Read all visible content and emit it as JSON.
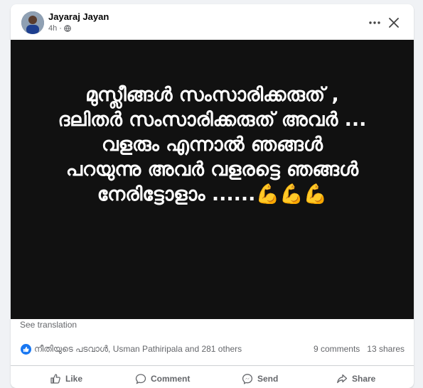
{
  "post": {
    "author": "Jayaraj Jayan",
    "time": "4h",
    "separator": "·",
    "privacy_icon": "globe-icon",
    "body_text": "മുസ്ലീങ്ങൾ സംസാരിക്കരുത് ,\nദലിതർ സംസാരിക്കരുത് അവർ ...\nവളരും എന്നാൽ ഞങ്ങൾ\nപറയുന്നു അവർ വളരട്ടെ ഞങ്ങൾ\nനേരിട്ടോളാം ......💪💪💪",
    "see_translation": "See translation"
  },
  "engagement": {
    "reactors_text": "നീതിയുടെ പടവാൾ, Usman Pathiripala and 281 others",
    "comments": "9 comments",
    "shares": "13 shares"
  },
  "actions": {
    "like": "Like",
    "comment": "Comment",
    "send": "Send",
    "share": "Share"
  },
  "colors": {
    "accent": "#1877f2",
    "image_bg": "#111111",
    "muted_text": "#65676b"
  }
}
